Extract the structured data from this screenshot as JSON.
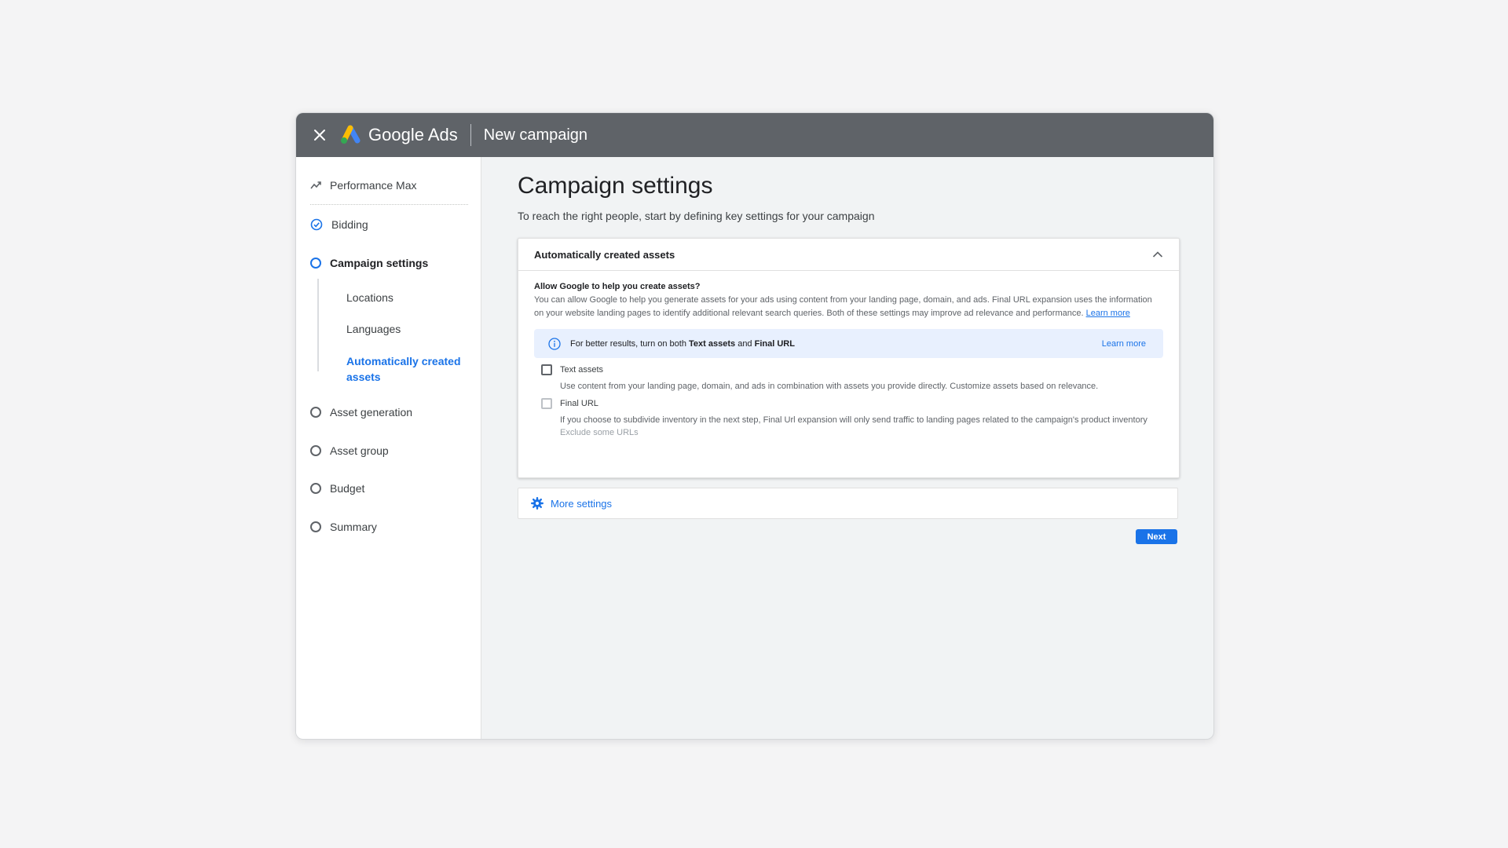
{
  "header": {
    "brand": "Google Ads",
    "page": "New campaign"
  },
  "sidebar": {
    "campaign_type": "Performance Max",
    "items": [
      {
        "label": "Bidding",
        "status": "complete"
      },
      {
        "label": "Campaign settings",
        "status": "current"
      },
      {
        "label": "Asset generation",
        "status": "pending"
      },
      {
        "label": "Asset group",
        "status": "pending"
      },
      {
        "label": "Budget",
        "status": "pending"
      },
      {
        "label": "Summary",
        "status": "pending"
      }
    ],
    "sub_items": [
      {
        "label": "Locations"
      },
      {
        "label": "Languages"
      },
      {
        "label": "Automatically created assets",
        "active": true
      }
    ]
  },
  "main": {
    "title": "Campaign settings",
    "intro": "To reach the right people, start by defining key settings for your campaign",
    "card": {
      "title": "Automatically created assets",
      "question": "Allow Google to help you create assets?",
      "description": "You can allow Google to help you generate assets for your ads using content from your landing page, domain, and ads. Final URL expansion uses the information on your website landing pages to identify additional relevant search queries. Both of these settings may improve ad relevance and performance.",
      "learn_more": "Learn more",
      "banner": {
        "prefix": "For better results, turn on both ",
        "bold1": "Text assets",
        "mid": " and ",
        "bold2": "Final URL",
        "link": "Learn more"
      },
      "options": [
        {
          "label": "Text assets",
          "checked": false,
          "description": "Use content from your landing page, domain, and ads in combination with assets you provide directly. Customize assets based on relevance."
        },
        {
          "label": "Final URL",
          "checked": false,
          "description": "If you choose to subdivide inventory in the next step, Final Url expansion will only send traffic to landing pages related to the campaign's product inventory"
        }
      ],
      "exclude_link": "Exclude some URLs"
    },
    "more_settings": "More settings",
    "next_button": "Next"
  },
  "colors": {
    "accent": "#1a73e8",
    "topbar": "#5f6368",
    "banner": "#e8f0fe"
  }
}
